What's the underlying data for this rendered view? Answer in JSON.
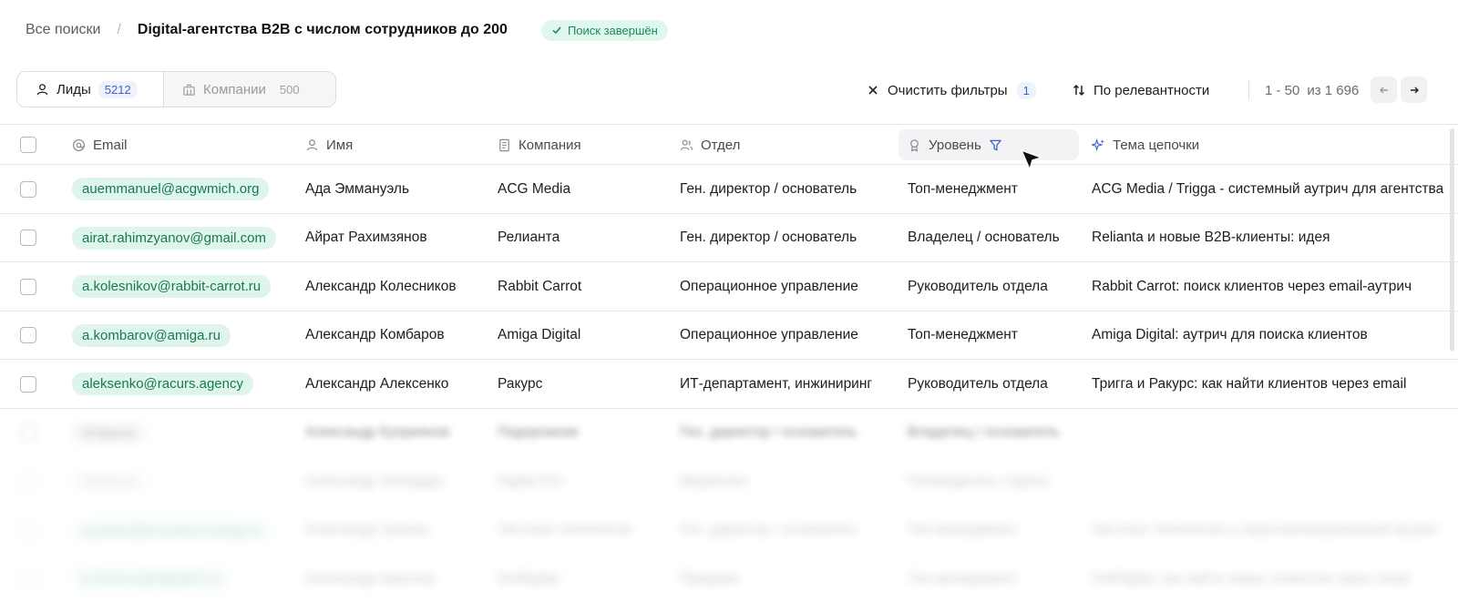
{
  "breadcrumb": {
    "all_searches": "Все поиски",
    "separator": "/",
    "title": "Digital-агентства B2B с числом сотрудников до 200"
  },
  "status": {
    "label": "Поиск завершён",
    "color": "#1b8a5a"
  },
  "tabs": [
    {
      "label": "Лиды",
      "count": "5212",
      "icon": "person-icon"
    },
    {
      "label": "Компании",
      "count": "500",
      "icon": "building-icon"
    }
  ],
  "toolbar": {
    "clear_filters": "Очистить фильтры",
    "filter_count": "1",
    "sort": "По релевантности",
    "range": "1 - 50",
    "total": "из 1 696"
  },
  "columns": {
    "email": "Email",
    "name": "Имя",
    "company": "Компания",
    "dept": "Отдел",
    "level": "Уровень",
    "topic": "Тема цепочки"
  },
  "rows": [
    {
      "email": "auemmanuel@acgwmich.org",
      "name": "Ада Эммануэль",
      "company": "ACG Media",
      "dept": "Ген. директор / основатель",
      "level": "Топ-менеджмент",
      "topic": "ACG Media / Trigga - системный аутрич для агентства"
    },
    {
      "email": "airat.rahimzyanov@gmail.com",
      "name": "Айрат Рахимзянов",
      "company": "Релианта",
      "dept": "Ген. директор / основатель",
      "level": "Владелец / основатель",
      "topic": "Relianta и новые B2B-клиенты: идея"
    },
    {
      "email": "a.kolesnikov@rabbit-carrot.ru",
      "name": "Александр Колесников",
      "company": "Rabbit Carrot",
      "dept": "Операционное управление",
      "level": "Руководитель отдела",
      "topic": "Rabbit Carrot: поиск клиентов через email-аутрич"
    },
    {
      "email": "a.kombarov@amiga.ru",
      "name": "Александр Комбаров",
      "company": "Amiga Digital",
      "dept": "Операционное управление",
      "level": "Топ-менеджмент",
      "topic": "Amiga Digital: аутрич для поиска клиентов"
    },
    {
      "email": "aleksenko@racurs.agency",
      "name": "Александр Алексенко",
      "company": "Ракурс",
      "dept": "ИТ-департамент, инжиниринг",
      "level": "Руководитель отдела",
      "topic": "Тригга и Ракурс: как найти клиентов через email"
    },
    {
      "email": "Открыть",
      "name": "Александр Куприянов",
      "company": "Подорожник",
      "dept": "Ген. директор / основатель",
      "level": "Владелец / основатель",
      "topic": ""
    },
    {
      "email": "Открыть",
      "name": "Александр Лапидарь",
      "company": "Digital Pro",
      "dept": "Маркетинг",
      "level": "Руководитель отдела",
      "topic": ""
    },
    {
      "email": "a.grishin@chesttechnology.ru",
      "name": "Александр Гришин",
      "company": "Честные технологии",
      "dept": "Ген. директор / основатель",
      "level": "Топ-менеджмент",
      "topic": "Честные технологии и персонализированный аутрич"
    },
    {
      "email": "a.krasnov@digitalfix.ru",
      "name": "Александр Краснов",
      "company": "DotDigital",
      "dept": "Продажи",
      "level": "Топ-менеджмент",
      "topic": "DotDigital: как найти новых клиентов через email"
    }
  ],
  "colors": {
    "accent": "#3a63c9",
    "chip_bg": "#dff5ec",
    "chip_text": "#157a52"
  }
}
